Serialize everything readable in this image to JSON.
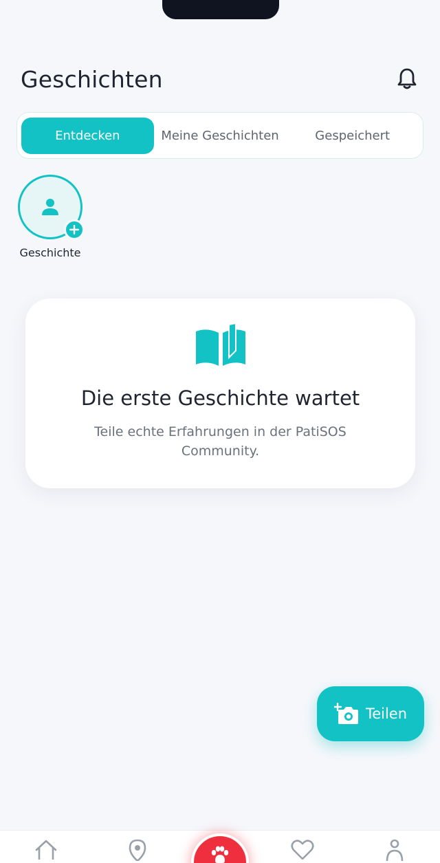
{
  "header": {
    "title": "Geschichten",
    "bell_icon": "bell-icon"
  },
  "tabs": [
    {
      "label": "Entdecken",
      "active": true
    },
    {
      "label": "Meine Geschichten",
      "active": false
    },
    {
      "label": "Gespeichert",
      "active": false
    }
  ],
  "story": {
    "label": "Geschichte",
    "icon": "user-icon",
    "badge_icon": "plus-icon"
  },
  "empty_state": {
    "icon": "open-book-icon",
    "title": "Die erste Geschichte wartet",
    "text": "Teile echte Erfahrungen in der PatiSOS Community."
  },
  "fab": {
    "label": "Teilen",
    "icon": "camera-plus-icon"
  },
  "bottom_nav": {
    "items": [
      "home-icon",
      "location-icon",
      "paw-icon",
      "heart-icon",
      "profile-icon"
    ]
  },
  "colors": {
    "accent": "#13c2c4",
    "emergency": "#ef2f3e",
    "background": "#f6f7fb"
  }
}
